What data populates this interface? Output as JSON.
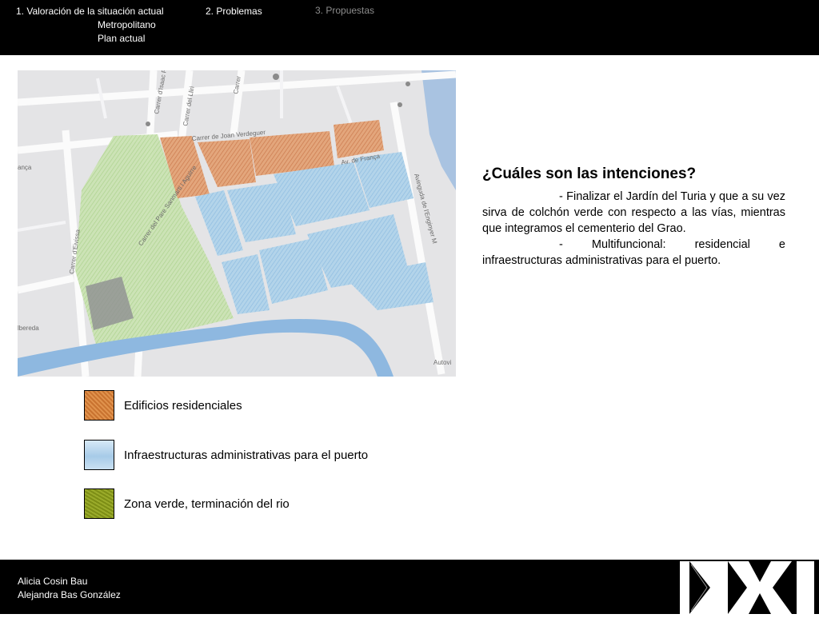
{
  "nav": {
    "item1": "1. Valoración de la situación actual",
    "item1_sub1": "Metropolitano",
    "item1_sub2": "Plan actual",
    "item2": "2. Problemas",
    "item3": "3. Propuestas"
  },
  "map": {
    "labels": {
      "isaac": "Carrer d'Isaac P",
      "lliri": "Carrer del Lliri",
      "carrer": "Carrer",
      "verdeguer": "Carrer de Joan Verdeguer",
      "franca": "Av. de França",
      "avinguda": "Avinguda de l'Enginyer M",
      "eivissa": "Carrer d'Eivissa",
      "pare": "Carrer del Pare Sanmarti i Aguirre",
      "anca": "ança",
      "albereda": "lbereda",
      "autovia": "Autovi"
    }
  },
  "content": {
    "title": "¿Cuáles son las intenciones?",
    "point1": "- Finalizar el Jardín del Turia y que a su vez sirva de colchón verde con respecto a las vías, mientras que integramos el cementerio del Grao.",
    "point2_head": "- Multifuncional: residencial e",
    "point2_tail": "infraestructuras administrativas para el puerto."
  },
  "legend": [
    {
      "label": "Edificios residenciales",
      "color": "#d4823a"
    },
    {
      "label": "Infraestructuras administrativas para el puerto",
      "color": "#a9cde8"
    },
    {
      "label": "Zona verde, terminación del rio",
      "color": "#8a9a1e"
    }
  ],
  "footer": {
    "author1": "Alicia Cosin Bau",
    "author2": "Alejandra Bas González"
  }
}
